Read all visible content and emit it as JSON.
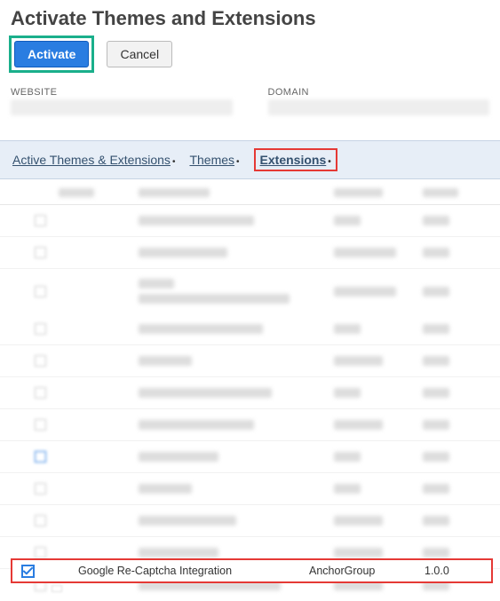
{
  "header": {
    "title": "Activate Themes and Extensions",
    "activate_label": "Activate",
    "cancel_label": "Cancel"
  },
  "fields": {
    "website_label": "WEBSITE",
    "domain_label": "DOMAIN"
  },
  "tabs": {
    "active_label": "Active Themes & Extensions",
    "themes_label": "Themes",
    "extensions_label": "Extensions"
  },
  "selected_row": {
    "name": "Google Re-Captcha Integration",
    "vendor": "AnchorGroup",
    "version": "1.0.0"
  }
}
